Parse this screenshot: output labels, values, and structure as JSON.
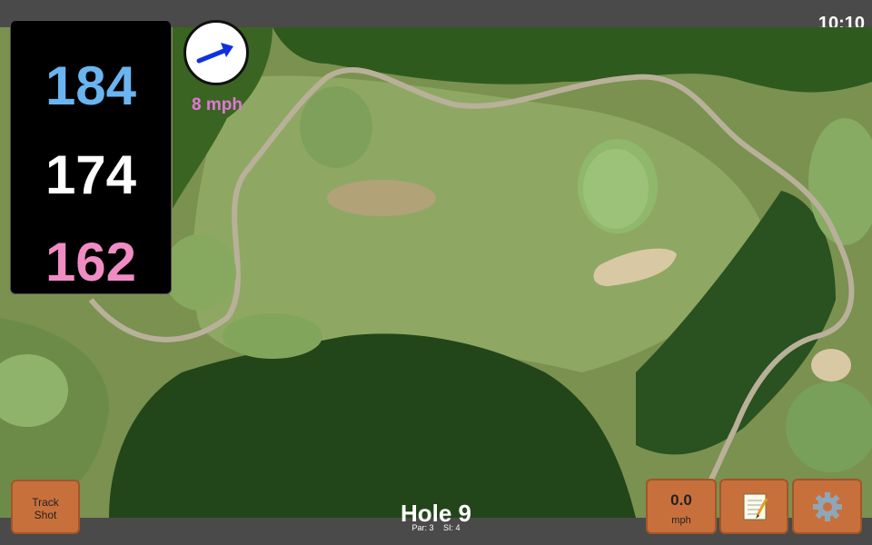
{
  "status": {
    "clock": "10:10"
  },
  "distances": {
    "back": "184",
    "middle": "174",
    "front": "162"
  },
  "wind": {
    "speed_label": "8 mph",
    "arrow_icon": "wind-direction-arrow-icon"
  },
  "buttons": {
    "track_shot_line1": "Track",
    "track_shot_line2": "Shot",
    "speed_value": "0.0",
    "speed_unit": "mph",
    "notes_icon": "notepad-icon",
    "settings_icon": "gear-icon"
  },
  "hole": {
    "title": "Hole 9",
    "par": "Par: 3",
    "si": "SI: 4"
  },
  "colors": {
    "back": "#6ab4f0",
    "middle": "#ffffff",
    "front": "#f08cc4",
    "wind": "#e277d8",
    "button": "#c8703c"
  }
}
